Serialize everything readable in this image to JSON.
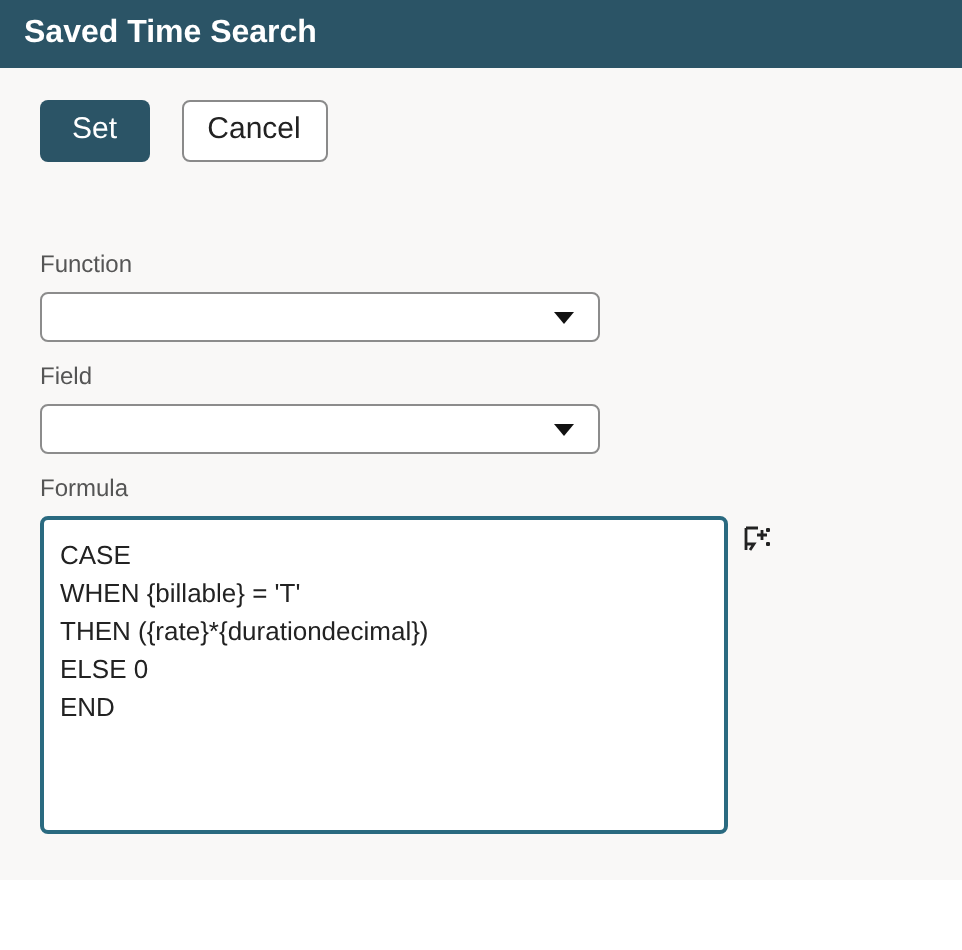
{
  "window": {
    "title": "Saved Time Search"
  },
  "buttons": [
    {
      "label": "Set",
      "kind": "primary"
    },
    {
      "label": "Cancel",
      "kind": "secondary"
    }
  ],
  "fields": [
    {
      "label": "Function",
      "kind": "select"
    },
    {
      "label": "Field",
      "kind": "select"
    },
    {
      "label": "Formula",
      "kind": "textarea",
      "focused": true,
      "value": "CASE\nWHEN {billable} = 'T'\nTHEN ({rate}*{durationdecimal})\nELSE 0\nEND"
    }
  ]
}
